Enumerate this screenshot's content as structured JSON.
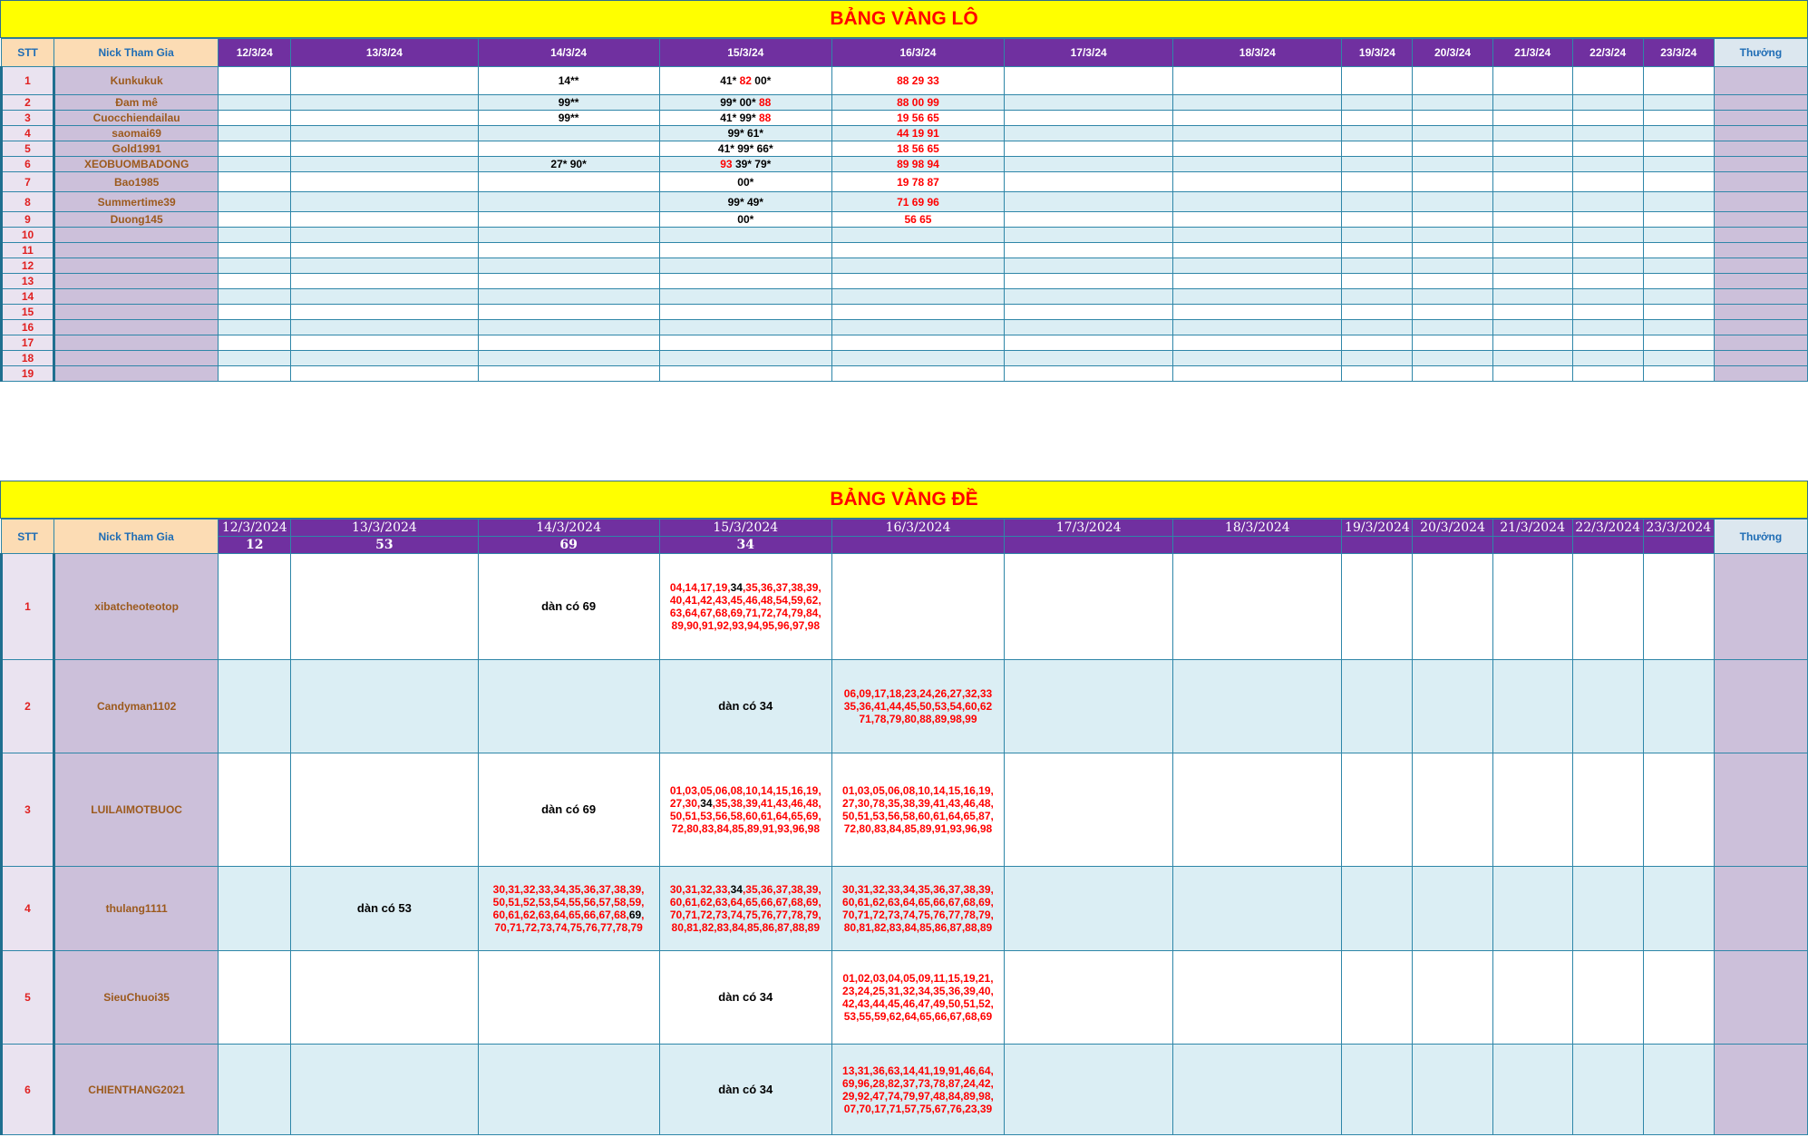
{
  "lo": {
    "title": "BẢNG VÀNG LÔ",
    "headers": {
      "stt": "STT",
      "nick": "Nick Tham Gia",
      "thuong": "Thưởng"
    },
    "dates": [
      "12/3/24",
      "13/3/24",
      "14/3/24",
      "15/3/24",
      "16/3/24",
      "17/3/24",
      "18/3/24",
      "19/3/24",
      "20/3/24",
      "21/3/24",
      "22/3/24",
      "23/3/24"
    ],
    "rows": [
      {
        "stt": "1",
        "nick": "Kunkukuk",
        "cells": {
          "2": [
            [
              "14**",
              "b"
            ]
          ],
          "3": [
            [
              "41* ",
              "b"
            ],
            [
              "82",
              "r"
            ],
            [
              " 00*",
              "b"
            ]
          ],
          "4": [
            [
              "88 29 33",
              "r"
            ]
          ]
        }
      },
      {
        "stt": "2",
        "nick": "Đam mê",
        "cells": {
          "2": [
            [
              "99**",
              "b"
            ]
          ],
          "3": [
            [
              "99* 00* ",
              "b"
            ],
            [
              "88",
              "r"
            ]
          ],
          "4": [
            [
              "88 00 99",
              "r"
            ]
          ]
        }
      },
      {
        "stt": "3",
        "nick": "Cuocchiendailau",
        "cells": {
          "2": [
            [
              "99**",
              "b"
            ]
          ],
          "3": [
            [
              "41* 99* ",
              "b"
            ],
            [
              "88",
              "r"
            ]
          ],
          "4": [
            [
              "19 56 65",
              "r"
            ]
          ]
        }
      },
      {
        "stt": "4",
        "nick": "saomai69",
        "cells": {
          "3": [
            [
              "99* 61*",
              "b"
            ]
          ],
          "4": [
            [
              "44 19 91",
              "r"
            ]
          ]
        }
      },
      {
        "stt": "5",
        "nick": "Gold1991",
        "cells": {
          "3": [
            [
              "41* 99* 66*",
              "b"
            ]
          ],
          "4": [
            [
              "18 56 65",
              "r"
            ]
          ]
        }
      },
      {
        "stt": "6",
        "nick": "XEOBUOMBADONG",
        "cells": {
          "2": [
            [
              "27* 90*",
              "b"
            ]
          ],
          "3": [
            [
              "93",
              "r"
            ],
            [
              " 39* 79*",
              "b"
            ]
          ],
          "4": [
            [
              "89 98 94",
              "r"
            ]
          ]
        }
      },
      {
        "stt": "7",
        "nick": "Bao1985",
        "cells": {
          "3": [
            [
              "00*",
              "b"
            ]
          ],
          "4": [
            [
              "19 78 87",
              "r"
            ]
          ]
        }
      },
      {
        "stt": "8",
        "nick": "Summertime39",
        "cells": {
          "3": [
            [
              "99* 49*",
              "b"
            ]
          ],
          "4": [
            [
              "71 69 96",
              "r"
            ]
          ]
        }
      },
      {
        "stt": "9",
        "nick": "Duong145",
        "cells": {
          "3": [
            [
              "00*",
              "b"
            ]
          ],
          "4": [
            [
              "56 65",
              "r"
            ]
          ]
        }
      },
      {
        "stt": "10",
        "nick": "",
        "cells": {}
      },
      {
        "stt": "11",
        "nick": "",
        "cells": {}
      },
      {
        "stt": "12",
        "nick": "",
        "cells": {}
      },
      {
        "stt": "13",
        "nick": "",
        "cells": {}
      },
      {
        "stt": "14",
        "nick": "",
        "cells": {}
      },
      {
        "stt": "15",
        "nick": "",
        "cells": {}
      },
      {
        "stt": "16",
        "nick": "",
        "cells": {}
      },
      {
        "stt": "17",
        "nick": "",
        "cells": {}
      },
      {
        "stt": "18",
        "nick": "",
        "cells": {}
      },
      {
        "stt": "19",
        "nick": "",
        "cells": {}
      }
    ]
  },
  "de": {
    "title": "BẢNG VÀNG ĐỀ",
    "headers": {
      "stt": "STT",
      "nick": "Nick Tham Gia",
      "thuong": "Thưởng"
    },
    "dates": [
      "12/3/2024",
      "13/3/2024",
      "14/3/2024",
      "15/3/2024",
      "16/3/2024",
      "17/3/2024",
      "18/3/2024",
      "19/3/2024",
      "20/3/2024",
      "21/3/2024",
      "22/3/2024",
      "23/3/2024"
    ],
    "results": [
      "12",
      "53",
      "69",
      "34",
      "",
      "",
      "",
      "",
      "",
      "",
      "",
      ""
    ],
    "rows": [
      {
        "stt": "1",
        "nick": "xibatcheoteotop",
        "cells": {
          "2": [
            [
              "dàn có 69",
              "dan"
            ]
          ],
          "3": [
            [
              "04,14,17,19,",
              "r"
            ],
            [
              "34",
              "b"
            ],
            [
              ",35,36,37,38,39,\n40,41,42,43,45,46,48,54,59,62,\n63,64,67,68,69,71,72,74,79,84,\n89,90,91,92,93,94,95,96,97,98",
              "r"
            ]
          ]
        }
      },
      {
        "stt": "2",
        "nick": "Candyman1102",
        "cells": {
          "3": [
            [
              "dàn có 34",
              "dan"
            ]
          ],
          "4": [
            [
              "06,09,17,18,23,24,26,27,32,33\n35,36,41,44,45,50,53,54,60,62\n71,78,79,80,88,89,98,99",
              "r"
            ]
          ]
        }
      },
      {
        "stt": "3",
        "nick": "LUILAIMOTBUOC",
        "cells": {
          "2": [
            [
              "dàn có 69",
              "dan"
            ]
          ],
          "3": [
            [
              "01,03,05,06,08,10,14,15,16,19,\n27,30,",
              "r"
            ],
            [
              "34",
              "b"
            ],
            [
              ",35,38,39,41,43,46,48,\n50,51,53,56,58,60,61,64,65,69,\n72,80,83,84,85,89,91,93,96,98",
              "r"
            ]
          ],
          "4": [
            [
              "01,03,05,06,08,10,14,15,16,19,\n27,30,78,35,38,39,41,43,46,48,\n50,51,53,56,58,60,61,64,65,87,\n72,80,83,84,85,89,91,93,96,98",
              "r"
            ]
          ]
        }
      },
      {
        "stt": "4",
        "nick": "thulang1111",
        "cells": {
          "1": [
            [
              "dàn có 53",
              "dan"
            ]
          ],
          "2": [
            [
              "30,31,32,33,34,35,36,37,38,39,\n50,51,52,53,54,55,56,57,58,59,\n60,61,62,63,64,65,66,67,68,",
              "r"
            ],
            [
              "69",
              "b"
            ],
            [
              ",\n70,71,72,73,74,75,76,77,78,79",
              "r"
            ]
          ],
          "3": [
            [
              "30,31,32,33,",
              "r"
            ],
            [
              "34",
              "b"
            ],
            [
              ",35,36,37,38,39,\n60,61,62,63,64,65,66,67,68,69,\n70,71,72,73,74,75,76,77,78,79,\n80,81,82,83,84,85,86,87,88,89",
              "r"
            ]
          ],
          "4": [
            [
              "30,31,32,33,34,35,36,37,38,39,\n60,61,62,63,64,65,66,67,68,69,\n70,71,72,73,74,75,76,77,78,79,\n80,81,82,83,84,85,86,87,88,89",
              "r"
            ]
          ]
        }
      },
      {
        "stt": "5",
        "nick": "SieuChuoi35",
        "cells": {
          "3": [
            [
              "dàn có 34",
              "dan"
            ]
          ],
          "4": [
            [
              "01,02,03,04,05,09,11,15,19,21,\n23,24,25,31,32,34,35,36,39,40,\n42,43,44,45,46,47,49,50,51,52,\n53,55,59,62,64,65,66,67,68,69",
              "r"
            ]
          ]
        }
      },
      {
        "stt": "6",
        "nick": "CHIENTHANG2021",
        "cells": {
          "3": [
            [
              "dàn có 34",
              "dan"
            ]
          ],
          "4": [
            [
              "13,31,36,63,14,41,19,91,46,64,\n69,96,28,82,37,73,78,87,24,42,\n29,92,47,74,79,97,48,84,89,98,\n07,70,17,71,57,75,67,76,23,39",
              "r"
            ]
          ]
        }
      }
    ]
  }
}
